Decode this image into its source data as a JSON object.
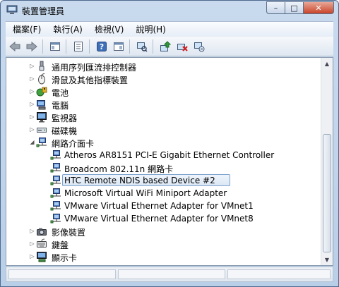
{
  "window": {
    "title": "裝置管理員"
  },
  "caption": {
    "minimize": "–",
    "maximize": "□",
    "close": "✕"
  },
  "menu": [
    "檔案(F)",
    "執行(A)",
    "檢視(V)",
    "說明(H)"
  ],
  "toolbar": [
    {
      "name": "back-arrow-icon"
    },
    {
      "name": "forward-arrow-icon"
    },
    {
      "name": "show-hide-console-tree-icon"
    },
    {
      "name": "properties-icon"
    },
    {
      "name": "help-icon"
    },
    {
      "name": "show-hide-action-pane-icon"
    },
    {
      "name": "scan-hardware-icon"
    },
    {
      "name": "update-driver-icon"
    },
    {
      "name": "uninstall-device-icon"
    },
    {
      "name": "enable-device-icon"
    }
  ],
  "tree": {
    "items": [
      {
        "label": "通用序列匯流排控制器",
        "level": 0,
        "state": "collapsed",
        "icon": "usb-controller-icon"
      },
      {
        "label": "滑鼠及其他指標裝置",
        "level": 0,
        "state": "collapsed",
        "icon": "mouse-icon"
      },
      {
        "label": "電池",
        "level": 0,
        "state": "collapsed",
        "icon": "battery-icon"
      },
      {
        "label": "電腦",
        "level": 0,
        "state": "collapsed",
        "icon": "computer-icon"
      },
      {
        "label": "監視器",
        "level": 0,
        "state": "collapsed",
        "icon": "monitor-icon"
      },
      {
        "label": "磁碟機",
        "level": 0,
        "state": "collapsed",
        "icon": "disk-drive-icon"
      },
      {
        "label": "網路介面卡",
        "level": 0,
        "state": "expanded",
        "icon": "network-adapter-icon"
      },
      {
        "label": "Atheros AR8151 PCI-E Gigabit Ethernet Controller",
        "level": 1,
        "icon": "network-adapter-icon"
      },
      {
        "label": "Broadcom 802.11n 網路卡",
        "level": 1,
        "icon": "network-adapter-icon"
      },
      {
        "label": "HTC Remote NDIS based Device #2",
        "level": 1,
        "icon": "network-adapter-icon",
        "selected": true
      },
      {
        "label": "Microsoft Virtual WiFi Miniport Adapter",
        "level": 1,
        "icon": "network-adapter-icon"
      },
      {
        "label": "VMware Virtual Ethernet Adapter for VMnet1",
        "level": 1,
        "icon": "network-adapter-icon"
      },
      {
        "label": "VMware Virtual Ethernet Adapter for VMnet8",
        "level": 1,
        "icon": "network-adapter-icon"
      },
      {
        "label": "影像裝置",
        "level": 0,
        "state": "collapsed",
        "icon": "imaging-device-icon"
      },
      {
        "label": "鍵盤",
        "level": 0,
        "state": "collapsed",
        "icon": "keyboard-icon"
      },
      {
        "label": "顯示卡",
        "level": 0,
        "state": "collapsed",
        "icon": "display-adapter-icon"
      }
    ]
  }
}
